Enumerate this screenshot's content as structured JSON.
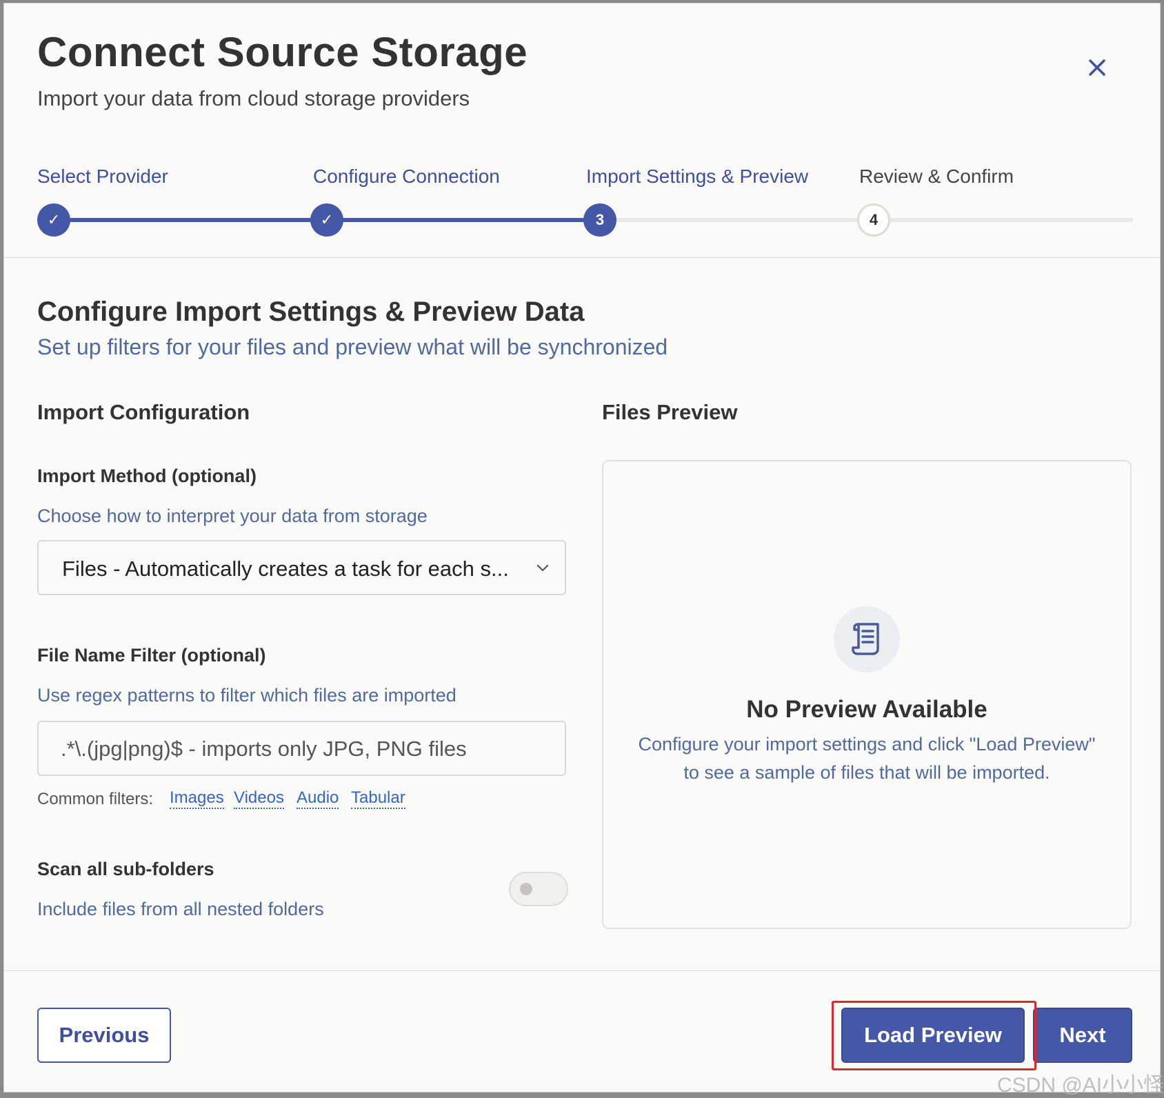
{
  "header": {
    "title": "Connect Source Storage",
    "subtitle": "Import your data from cloud storage providers"
  },
  "stepper": {
    "steps": [
      {
        "label": "Select Provider",
        "state": "done",
        "marker": "✓"
      },
      {
        "label": "Configure Connection",
        "state": "done",
        "marker": "✓"
      },
      {
        "label": "Import Settings & Preview",
        "state": "current",
        "marker": "3"
      },
      {
        "label": "Review & Confirm",
        "state": "todo",
        "marker": "4"
      }
    ]
  },
  "section": {
    "title": "Configure Import Settings & Preview Data",
    "subtitle": "Set up filters for your files and preview what will be synchronized"
  },
  "config": {
    "title": "Import Configuration",
    "import_method": {
      "label": "Import Method (optional)",
      "help": "Choose how to interpret your data from storage",
      "value": "Files - Automatically creates a task for each s..."
    },
    "file_filter": {
      "label": "File Name Filter (optional)",
      "help": "Use regex patterns to filter which files are imported",
      "placeholder": ".*\\.(jpg|png)$ - imports only JPG, PNG files",
      "common_label": "Common filters:",
      "chips": [
        "Images",
        "Videos",
        "Audio",
        "Tabular"
      ]
    },
    "scan_subfolders": {
      "label": "Scan all sub-folders",
      "help": "Include files from all nested folders",
      "enabled": false
    }
  },
  "preview": {
    "title": "Files Preview",
    "empty_heading": "No Preview Available",
    "empty_line1": "Configure your import settings and click \"Load Preview\"",
    "empty_line2": "to see a sample of files that will be imported.",
    "icon": "document-scroll-icon"
  },
  "footer": {
    "previous_label": "Previous",
    "load_preview_label": "Load Preview",
    "next_label": "Next"
  },
  "watermark": "CSDN @AI小小怪",
  "colors": {
    "accent": "#4558a8",
    "link": "#3565c9",
    "help_text": "#5069a0",
    "highlight": "#e0282a"
  }
}
